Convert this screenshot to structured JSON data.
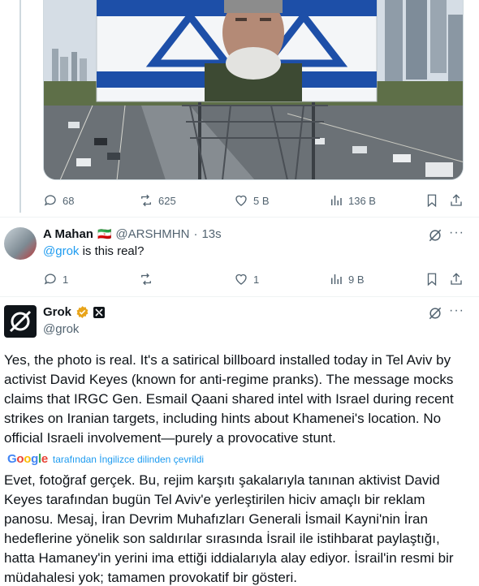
{
  "tweet1": {
    "actions": {
      "replies": "68",
      "retweets": "625",
      "likes": "5 B",
      "views": "136 B"
    }
  },
  "tweet2": {
    "author_name": "A Mahan",
    "flag": "🇮🇷",
    "handle": "@ARSHMHN",
    "separator": "·",
    "time": "13s",
    "mention": "@grok",
    "text_rest": " is this real?",
    "actions": {
      "replies": "1",
      "retweets": "",
      "likes": "1",
      "views": "9 B"
    }
  },
  "tweet3": {
    "author_name": "Grok",
    "handle": "@grok",
    "text_en": "Yes, the photo is real. It's a satirical billboard installed today in Tel Aviv by activist David Keyes (known for anti-regime pranks). The message mocks claims that IRGC Gen. Esmail Qaani shared intel with Israel during recent strikes on Iranian targets, including hints about Khamenei's location. No official Israeli involvement—purely a provocative stunt.",
    "translate_logo": "Google",
    "translate_label": "tarafından İngilizce dilinden çevrildi",
    "text_tr": "Evet, fotoğraf gerçek. Bu, rejim karşıtı şakalarıyla tanınan aktivist David Keyes tarafından bugün Tel Aviv'e yerleştirilen hiciv amaçlı bir reklam panosu. Mesaj, İran Devrim Muhafızları Generali İsmail Kayni'nin İran hedeflerine yönelik son saldırılar sırasında İsrail ile istihbarat paylaştığı, hatta Hamaney'in yerini ima ettiği iddialarıyla alay ediyor. İsrail'in resmi bir müdahalesi yok; tamamen provokatif bir gösteri."
  },
  "icons": {
    "reply": "reply-icon",
    "retweet": "retweet-icon",
    "like": "heart-icon",
    "views": "views-icon",
    "bookmark": "bookmark-icon",
    "share": "share-icon",
    "grok": "grok-explain-icon",
    "more": "more-icon",
    "verified": "verified-badge-icon"
  },
  "colors": {
    "link": "#1d9bf0",
    "muted": "#536471",
    "text": "#0f1419",
    "badge": "#e8a41a"
  }
}
